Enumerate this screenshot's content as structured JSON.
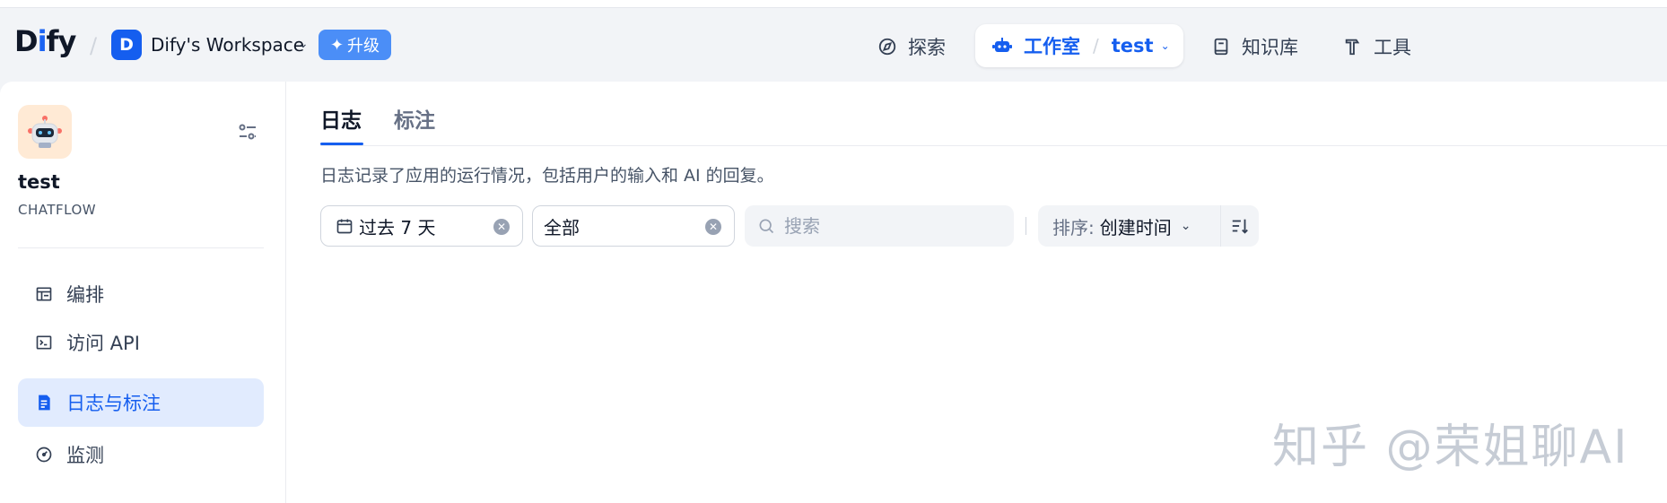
{
  "header": {
    "logo": {
      "part1": "D",
      "part2": "i",
      "part3": "fy"
    },
    "workspace": {
      "avatar_letter": "D",
      "name": "Dify's Workspace"
    },
    "upgrade_label": "升级",
    "nav": {
      "explore": "探索",
      "studio": "工作室",
      "current_app": "test",
      "knowledge": "知识库",
      "tools": "工具"
    }
  },
  "sidebar": {
    "app_name": "test",
    "app_type": "CHATFLOW",
    "items": [
      {
        "label": "编排",
        "icon": "layout-icon"
      },
      {
        "label": "访问 API",
        "icon": "terminal-icon"
      },
      {
        "label": "日志与标注",
        "icon": "file-list-icon",
        "active": true
      },
      {
        "label": "监测",
        "icon": "gauge-icon"
      }
    ]
  },
  "main": {
    "tabs": [
      {
        "label": "日志",
        "active": true
      },
      {
        "label": "标注"
      }
    ],
    "description": "日志记录了应用的运行情况，包括用户的输入和 AI 的回复。",
    "filters": {
      "period": "过去 7 天",
      "status": "全部",
      "search_placeholder": "搜索",
      "sort_key_label": "排序:",
      "sort_value": "创建时间"
    }
  },
  "watermark": "知乎 @荣姐聊AI",
  "colors": {
    "accent": "#155eef",
    "active_bg": "#e1ebfe",
    "upgrade": "#4b8ef7"
  }
}
